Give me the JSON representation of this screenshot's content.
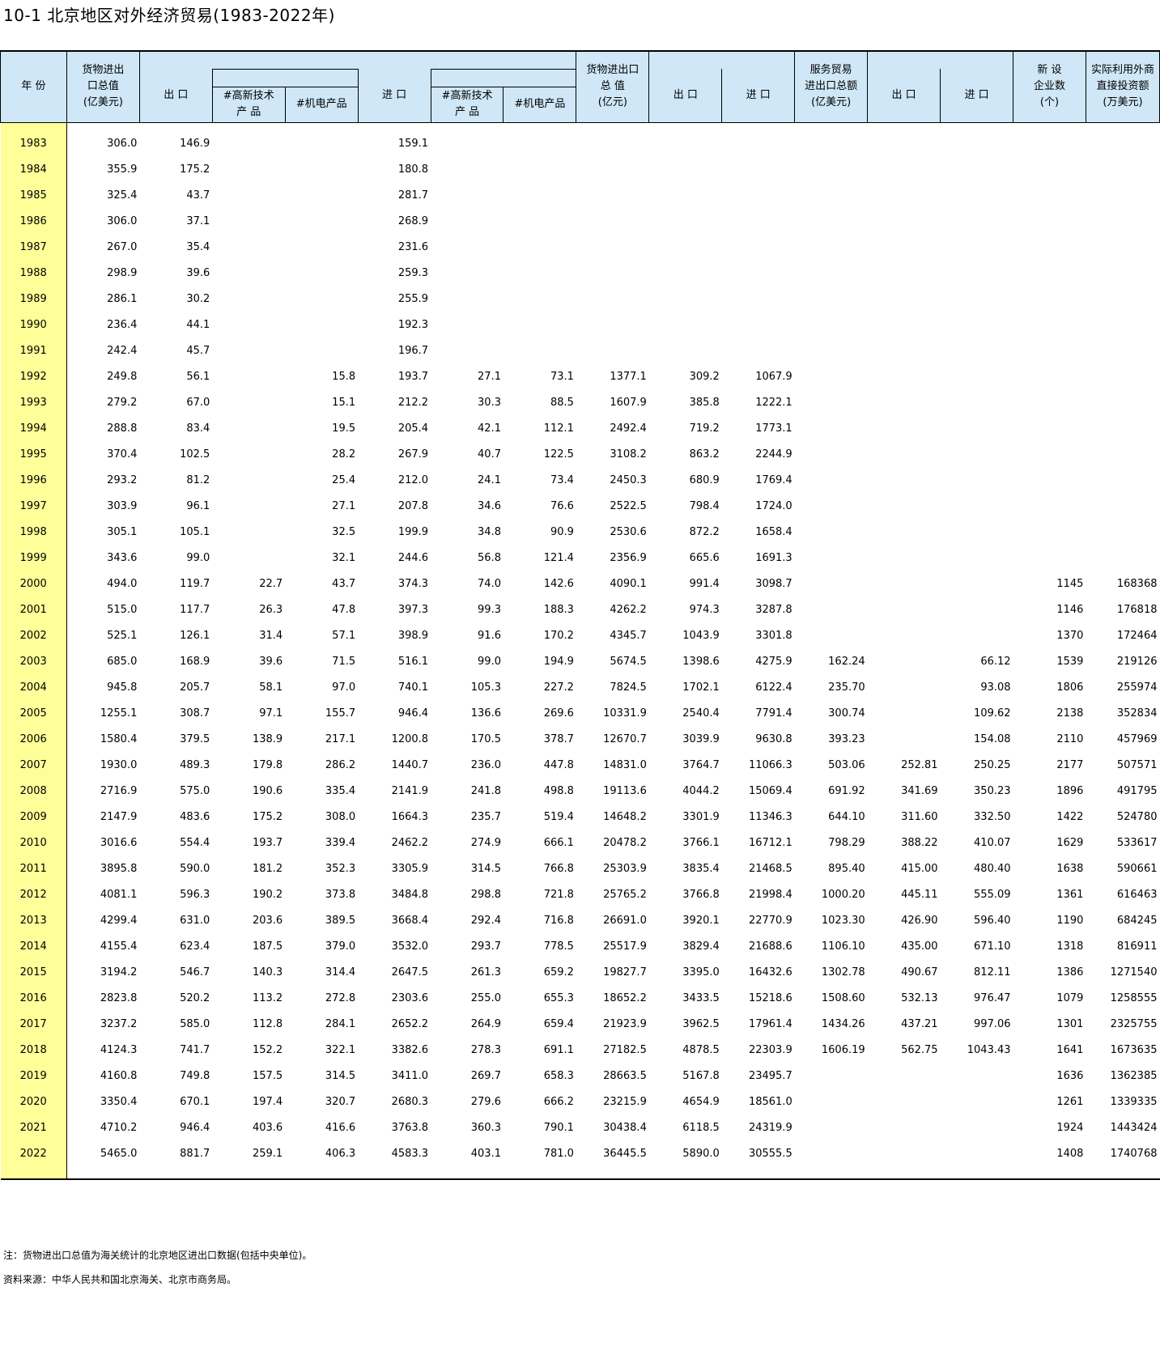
{
  "title": "10-1   北京地区对外经济贸易(1983-2022年)",
  "headers": {
    "year": "年 份",
    "goods_usd": "货物进出\n口总值\n(亿美元)",
    "export": "出 口",
    "export_hightech": "#高新技术\n产 品",
    "export_mech": "#机电产品",
    "import": "进 口",
    "import_hightech": "#高新技术\n产 品",
    "import_mech": "#机电产品",
    "goods_cny": "货物进出口\n总 值\n(亿元)",
    "export_cny": "出 口",
    "import_cny": "进 口",
    "services": "服务贸易\n进出口总额\n(亿美元)",
    "services_export": "出 口",
    "services_import": "进 口",
    "new_ent": "新 设\n企业数\n(个)",
    "fdi": "实际利用外商\n直接投资额\n(万美元)"
  },
  "rows": [
    [
      "1983",
      "306.0",
      "146.9",
      "",
      "",
      "159.1",
      "",
      "",
      "",
      "",
      "",
      "",
      "",
      "",
      "",
      ""
    ],
    [
      "1984",
      "355.9",
      "175.2",
      "",
      "",
      "180.8",
      "",
      "",
      "",
      "",
      "",
      "",
      "",
      "",
      "",
      ""
    ],
    [
      "1985",
      "325.4",
      "43.7",
      "",
      "",
      "281.7",
      "",
      "",
      "",
      "",
      "",
      "",
      "",
      "",
      "",
      ""
    ],
    [
      "1986",
      "306.0",
      "37.1",
      "",
      "",
      "268.9",
      "",
      "",
      "",
      "",
      "",
      "",
      "",
      "",
      "",
      ""
    ],
    [
      "1987",
      "267.0",
      "35.4",
      "",
      "",
      "231.6",
      "",
      "",
      "",
      "",
      "",
      "",
      "",
      "",
      "",
      ""
    ],
    [
      "1988",
      "298.9",
      "39.6",
      "",
      "",
      "259.3",
      "",
      "",
      "",
      "",
      "",
      "",
      "",
      "",
      "",
      ""
    ],
    [
      "1989",
      "286.1",
      "30.2",
      "",
      "",
      "255.9",
      "",
      "",
      "",
      "",
      "",
      "",
      "",
      "",
      "",
      ""
    ],
    [
      "1990",
      "236.4",
      "44.1",
      "",
      "",
      "192.3",
      "",
      "",
      "",
      "",
      "",
      "",
      "",
      "",
      "",
      ""
    ],
    [
      "1991",
      "242.4",
      "45.7",
      "",
      "",
      "196.7",
      "",
      "",
      "",
      "",
      "",
      "",
      "",
      "",
      "",
      ""
    ],
    [
      "1992",
      "249.8",
      "56.1",
      "",
      "15.8",
      "193.7",
      "27.1",
      "73.1",
      "1377.1",
      "309.2",
      "1067.9",
      "",
      "",
      "",
      "",
      ""
    ],
    [
      "1993",
      "279.2",
      "67.0",
      "",
      "15.1",
      "212.2",
      "30.3",
      "88.5",
      "1607.9",
      "385.8",
      "1222.1",
      "",
      "",
      "",
      "",
      ""
    ],
    [
      "1994",
      "288.8",
      "83.4",
      "",
      "19.5",
      "205.4",
      "42.1",
      "112.1",
      "2492.4",
      "719.2",
      "1773.1",
      "",
      "",
      "",
      "",
      ""
    ],
    [
      "1995",
      "370.4",
      "102.5",
      "",
      "28.2",
      "267.9",
      "40.7",
      "122.5",
      "3108.2",
      "863.2",
      "2244.9",
      "",
      "",
      "",
      "",
      ""
    ],
    [
      "1996",
      "293.2",
      "81.2",
      "",
      "25.4",
      "212.0",
      "24.1",
      "73.4",
      "2450.3",
      "680.9",
      "1769.4",
      "",
      "",
      "",
      "",
      ""
    ],
    [
      "1997",
      "303.9",
      "96.1",
      "",
      "27.1",
      "207.8",
      "34.6",
      "76.6",
      "2522.5",
      "798.4",
      "1724.0",
      "",
      "",
      "",
      "",
      ""
    ],
    [
      "1998",
      "305.1",
      "105.1",
      "",
      "32.5",
      "199.9",
      "34.8",
      "90.9",
      "2530.6",
      "872.2",
      "1658.4",
      "",
      "",
      "",
      "",
      ""
    ],
    [
      "1999",
      "343.6",
      "99.0",
      "",
      "32.1",
      "244.6",
      "56.8",
      "121.4",
      "2356.9",
      "665.6",
      "1691.3",
      "",
      "",
      "",
      "",
      ""
    ],
    [
      "2000",
      "494.0",
      "119.7",
      "22.7",
      "43.7",
      "374.3",
      "74.0",
      "142.6",
      "4090.1",
      "991.4",
      "3098.7",
      "",
      "",
      "",
      "1145",
      "168368"
    ],
    [
      "2001",
      "515.0",
      "117.7",
      "26.3",
      "47.8",
      "397.3",
      "99.3",
      "188.3",
      "4262.2",
      "974.3",
      "3287.8",
      "",
      "",
      "",
      "1146",
      "176818"
    ],
    [
      "2002",
      "525.1",
      "126.1",
      "31.4",
      "57.1",
      "398.9",
      "91.6",
      "170.2",
      "4345.7",
      "1043.9",
      "3301.8",
      "",
      "",
      "",
      "1370",
      "172464"
    ],
    [
      "2003",
      "685.0",
      "168.9",
      "39.6",
      "71.5",
      "516.1",
      "99.0",
      "194.9",
      "5674.5",
      "1398.6",
      "4275.9",
      "162.24",
      "",
      "66.12",
      "1539",
      "219126"
    ],
    [
      "2004",
      "945.8",
      "205.7",
      "58.1",
      "97.0",
      "740.1",
      "105.3",
      "227.2",
      "7824.5",
      "1702.1",
      "6122.4",
      "235.70",
      "",
      "93.08",
      "1806",
      "255974"
    ],
    [
      "2005",
      "1255.1",
      "308.7",
      "97.1",
      "155.7",
      "946.4",
      "136.6",
      "269.6",
      "10331.9",
      "2540.4",
      "7791.4",
      "300.74",
      "",
      "109.62",
      "2138",
      "352834"
    ],
    [
      "2006",
      "1580.4",
      "379.5",
      "138.9",
      "217.1",
      "1200.8",
      "170.5",
      "378.7",
      "12670.7",
      "3039.9",
      "9630.8",
      "393.23",
      "",
      "154.08",
      "2110",
      "457969"
    ],
    [
      "2007",
      "1930.0",
      "489.3",
      "179.8",
      "286.2",
      "1440.7",
      "236.0",
      "447.8",
      "14831.0",
      "3764.7",
      "11066.3",
      "503.06",
      "252.81",
      "250.25",
      "2177",
      "507571"
    ],
    [
      "2008",
      "2716.9",
      "575.0",
      "190.6",
      "335.4",
      "2141.9",
      "241.8",
      "498.8",
      "19113.6",
      "4044.2",
      "15069.4",
      "691.92",
      "341.69",
      "350.23",
      "1896",
      "491795"
    ],
    [
      "2009",
      "2147.9",
      "483.6",
      "175.2",
      "308.0",
      "1664.3",
      "235.7",
      "519.4",
      "14648.2",
      "3301.9",
      "11346.3",
      "644.10",
      "311.60",
      "332.50",
      "1422",
      "524780"
    ],
    [
      "2010",
      "3016.6",
      "554.4",
      "193.7",
      "339.4",
      "2462.2",
      "274.9",
      "666.1",
      "20478.2",
      "3766.1",
      "16712.1",
      "798.29",
      "388.22",
      "410.07",
      "1629",
      "533617"
    ],
    [
      "2011",
      "3895.8",
      "590.0",
      "181.2",
      "352.3",
      "3305.9",
      "314.5",
      "766.8",
      "25303.9",
      "3835.4",
      "21468.5",
      "895.40",
      "415.00",
      "480.40",
      "1638",
      "590661"
    ],
    [
      "2012",
      "4081.1",
      "596.3",
      "190.2",
      "373.8",
      "3484.8",
      "298.8",
      "721.8",
      "25765.2",
      "3766.8",
      "21998.4",
      "1000.20",
      "445.11",
      "555.09",
      "1361",
      "616463"
    ],
    [
      "2013",
      "4299.4",
      "631.0",
      "203.6",
      "389.5",
      "3668.4",
      "292.4",
      "716.8",
      "26691.0",
      "3920.1",
      "22770.9",
      "1023.30",
      "426.90",
      "596.40",
      "1190",
      "684245"
    ],
    [
      "2014",
      "4155.4",
      "623.4",
      "187.5",
      "379.0",
      "3532.0",
      "293.7",
      "778.5",
      "25517.9",
      "3829.4",
      "21688.6",
      "1106.10",
      "435.00",
      "671.10",
      "1318",
      "816911"
    ],
    [
      "2015",
      "3194.2",
      "546.7",
      "140.3",
      "314.4",
      "2647.5",
      "261.3",
      "659.2",
      "19827.7",
      "3395.0",
      "16432.6",
      "1302.78",
      "490.67",
      "812.11",
      "1386",
      "1271540"
    ],
    [
      "2016",
      "2823.8",
      "520.2",
      "113.2",
      "272.8",
      "2303.6",
      "255.0",
      "655.3",
      "18652.2",
      "3433.5",
      "15218.6",
      "1508.60",
      "532.13",
      "976.47",
      "1079",
      "1258555"
    ],
    [
      "2017",
      "3237.2",
      "585.0",
      "112.8",
      "284.1",
      "2652.2",
      "264.9",
      "659.4",
      "21923.9",
      "3962.5",
      "17961.4",
      "1434.26",
      "437.21",
      "997.06",
      "1301",
      "2325755"
    ],
    [
      "2018",
      "4124.3",
      "741.7",
      "152.2",
      "322.1",
      "3382.6",
      "278.3",
      "691.1",
      "27182.5",
      "4878.5",
      "22303.9",
      "1606.19",
      "562.75",
      "1043.43",
      "1641",
      "1673635"
    ],
    [
      "2019",
      "4160.8",
      "749.8",
      "157.5",
      "314.5",
      "3411.0",
      "269.7",
      "658.3",
      "28663.5",
      "5167.8",
      "23495.7",
      "",
      "",
      "",
      "1636",
      "1362385"
    ],
    [
      "2020",
      "3350.4",
      "670.1",
      "197.4",
      "320.7",
      "2680.3",
      "279.6",
      "666.2",
      "23215.9",
      "4654.9",
      "18561.0",
      "",
      "",
      "",
      "1261",
      "1339335"
    ],
    [
      "2021",
      "4710.2",
      "946.4",
      "403.6",
      "416.6",
      "3763.8",
      "360.3",
      "790.1",
      "30438.4",
      "6118.5",
      "24319.9",
      "",
      "",
      "",
      "1924",
      "1443424"
    ],
    [
      "2022",
      "5465.0",
      "881.7",
      "259.1",
      "406.3",
      "4583.3",
      "403.1",
      "781.0",
      "36445.5",
      "5890.0",
      "30555.5",
      "",
      "",
      "",
      "1408",
      "1740768"
    ]
  ],
  "footnote": "注：货物进出口总值为海关统计的北京地区进出口数据(包括中央单位)。",
  "source": "资料来源：中华人民共和国北京海关、北京市商务局。"
}
